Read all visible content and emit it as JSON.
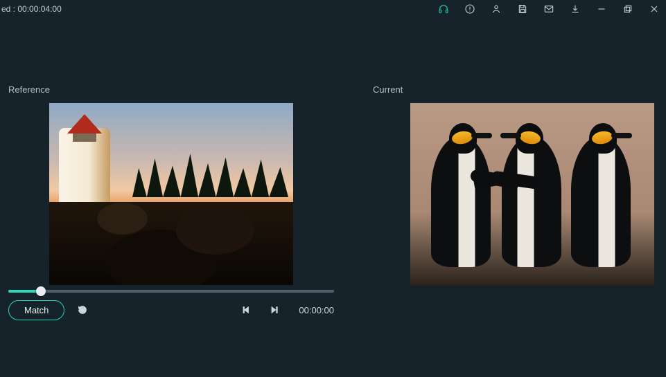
{
  "titlebar": {
    "status_prefix": "ed :",
    "status_time": "00:00:04:00"
  },
  "toolbar_icons": {
    "headphones": "headphones-icon",
    "alert": "alert-circle-icon",
    "user": "user-icon",
    "save": "save-icon",
    "mail": "mail-icon",
    "download": "download-icon",
    "minimize": "minimize-icon",
    "maximize": "maximize-restore-icon",
    "close": "close-icon"
  },
  "panels": {
    "reference_label": "Reference",
    "current_label": "Current"
  },
  "controls": {
    "match_label": "Match",
    "reset_label": "Reset",
    "prev_frame_label": "Previous frame",
    "play_label": "Play / Next frame",
    "timecode": "00:00:00"
  },
  "slider": {
    "value_percent": 10
  },
  "colors": {
    "accent": "#25d4b4",
    "bg": "#17232b"
  }
}
